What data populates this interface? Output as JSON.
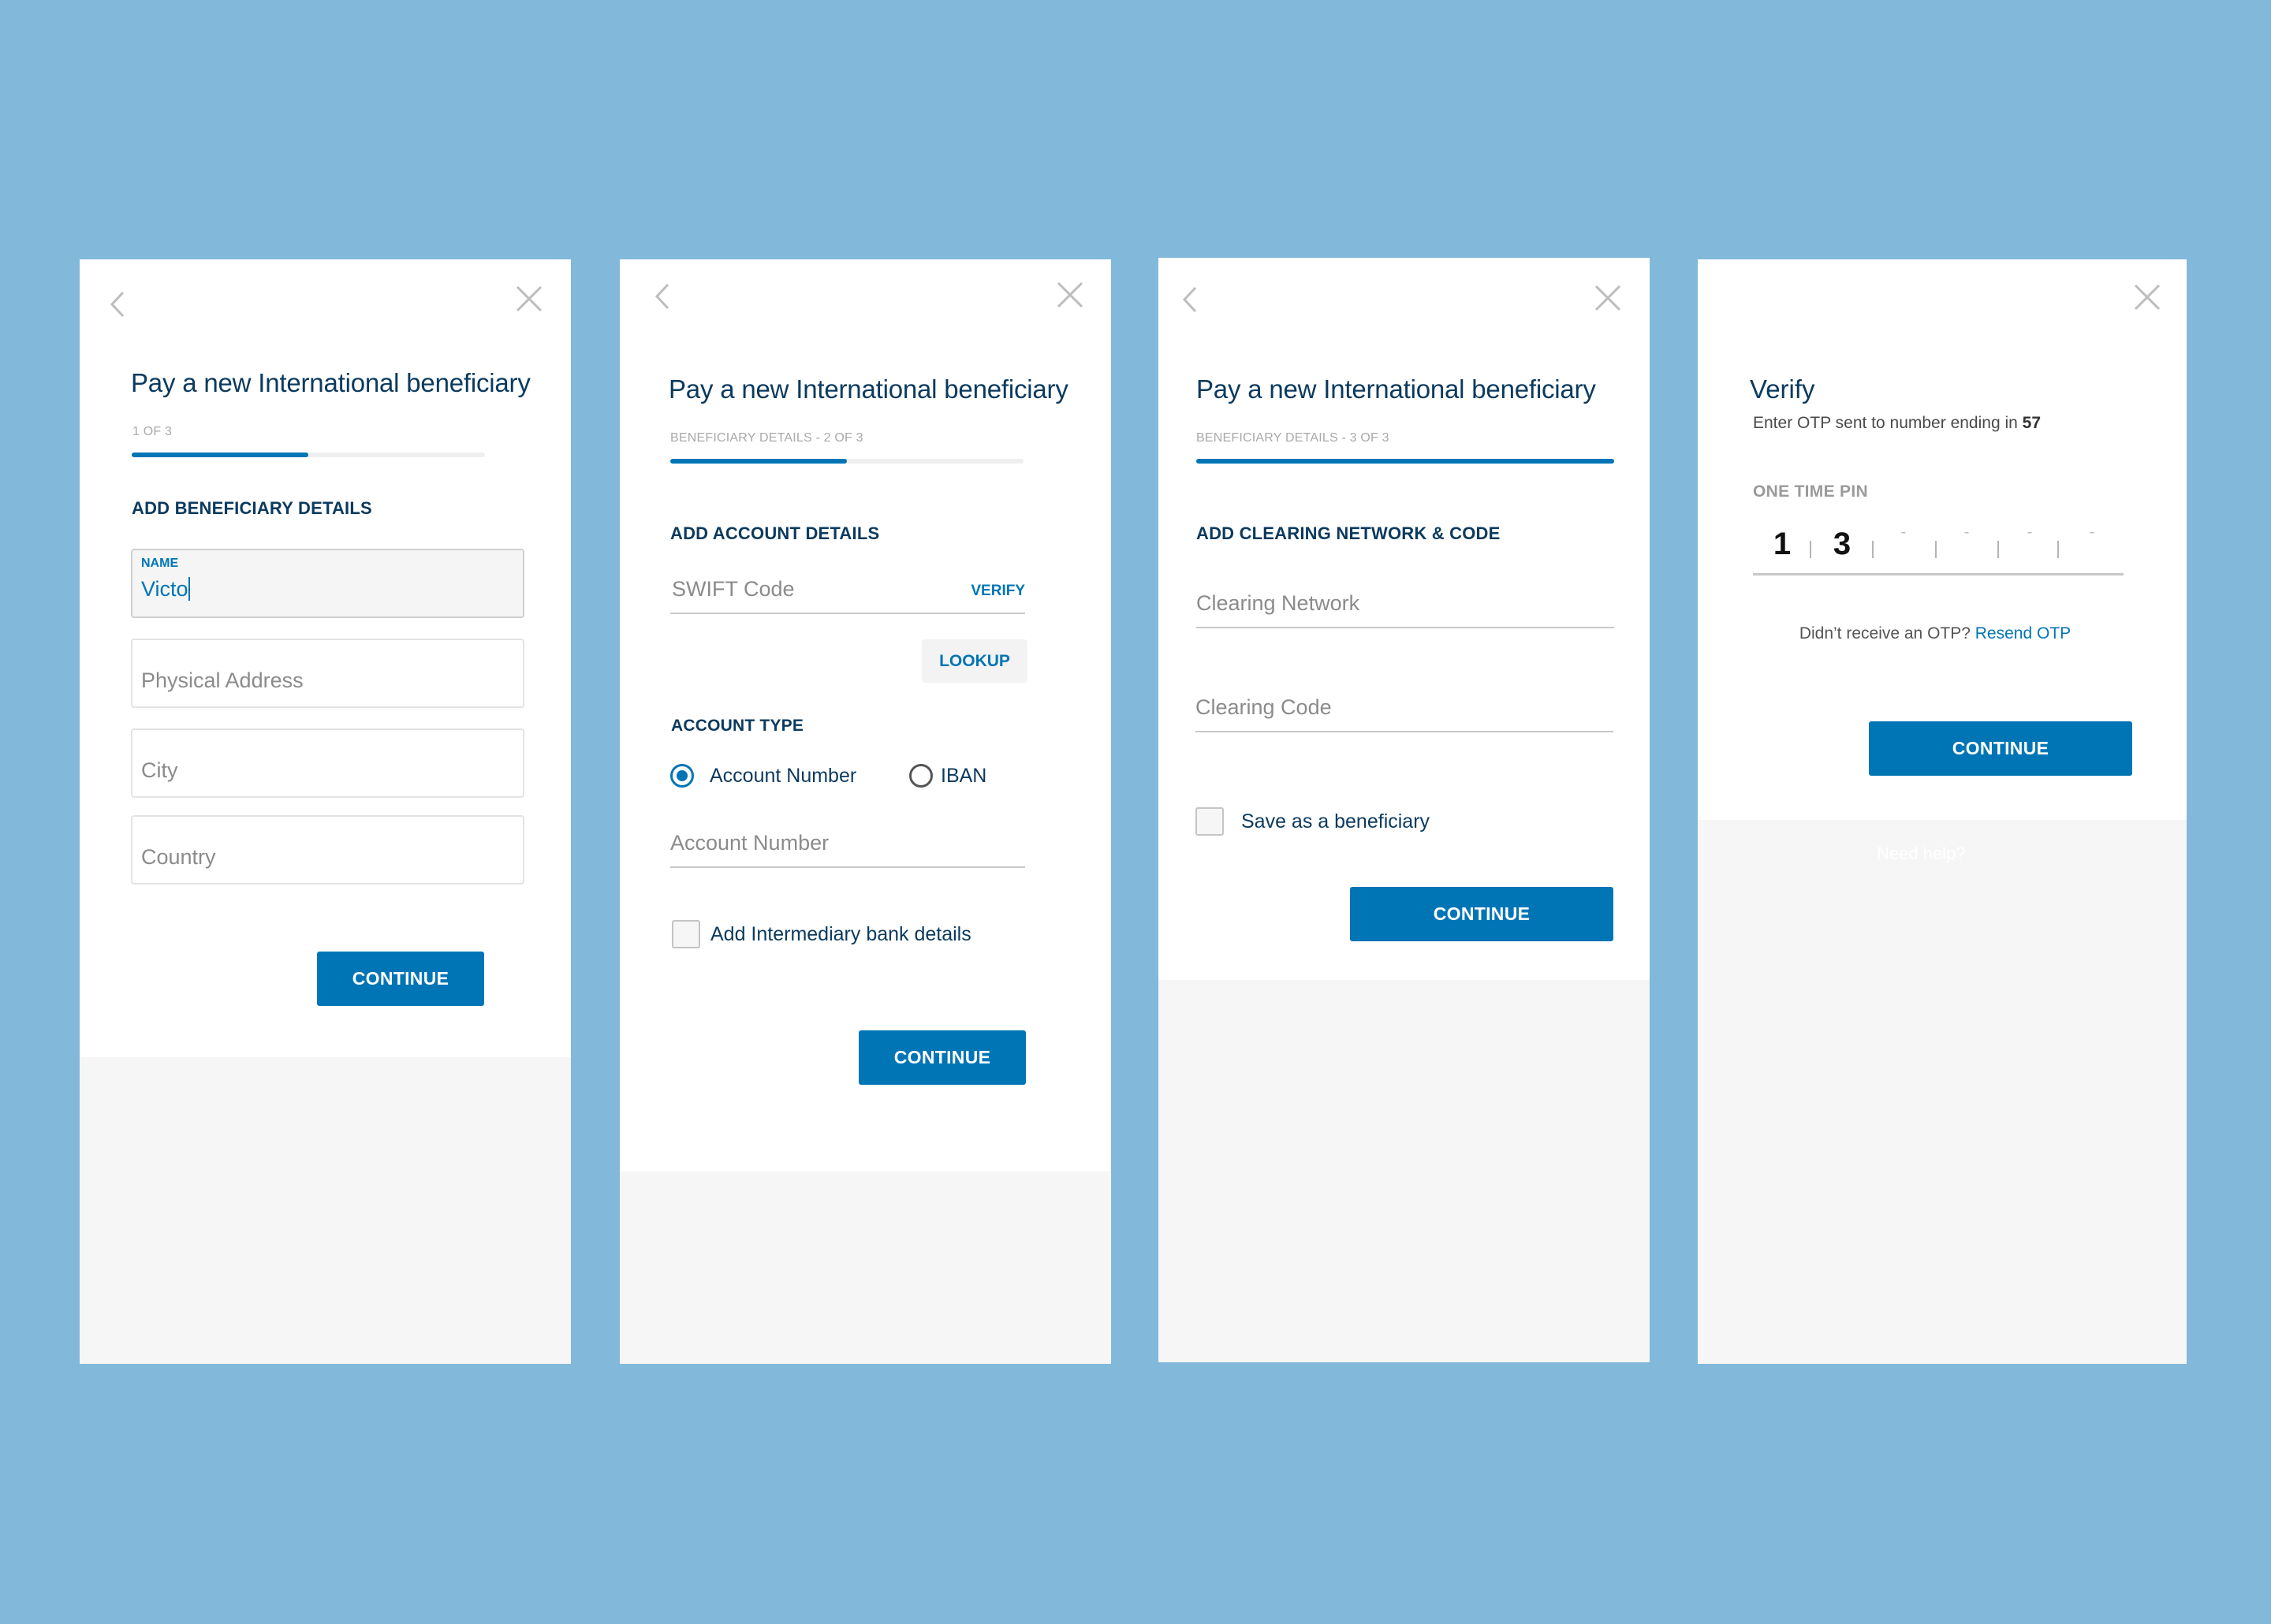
{
  "colors": {
    "background": "#82b9da",
    "accent": "#0075b6",
    "heading": "#0b3a5e"
  },
  "screens": [
    {
      "id": "step1",
      "title": "Pay a new International beneficiary",
      "step_label": "1 OF 3",
      "progress_percent": 50,
      "section_title": "ADD BENEFICIARY DETAILS",
      "fields": [
        {
          "label": "NAME",
          "value": "Victo",
          "active": true
        },
        {
          "placeholder": "Physical Address",
          "value": ""
        },
        {
          "placeholder": "City",
          "value": ""
        },
        {
          "placeholder": "Country",
          "value": ""
        }
      ],
      "continue_label": "CONTINUE"
    },
    {
      "id": "step2",
      "title": "Pay a new International beneficiary",
      "step_label": "BENEFICIARY DETAILS - 2 OF 3",
      "progress_percent": 50,
      "section_title": "ADD ACCOUNT DETAILS",
      "swift_placeholder": "SWIFT Code",
      "verify_label": "VERIFY",
      "lookup_label": "LOOKUP",
      "account_type_title": "ACCOUNT TYPE",
      "account_types": [
        {
          "label": "Account Number",
          "checked": true
        },
        {
          "label": "IBAN",
          "checked": false
        }
      ],
      "account_number_placeholder": "Account Number",
      "intermediary_label": "Add Intermediary bank details",
      "intermediary_checked": false,
      "continue_label": "CONTINUE"
    },
    {
      "id": "step3",
      "title": "Pay a new International beneficiary",
      "step_label": "BENEFICIARY DETAILS - 3 OF 3",
      "progress_percent": 100,
      "section_title": "ADD CLEARING NETWORK & CODE",
      "clearing_network_placeholder": "Clearing Network",
      "clearing_code_placeholder": "Clearing Code",
      "save_beneficiary_label": "Save as a beneficiary",
      "save_beneficiary_checked": false,
      "continue_label": "CONTINUE"
    },
    {
      "id": "verify",
      "title": "Verify",
      "subtitle_prefix": "Enter OTP sent to number ending in ",
      "subtitle_number": "57",
      "otp_label": "ONE TIME PIN",
      "otp_digits": [
        "1",
        "3",
        "-",
        "-",
        "-",
        "-"
      ],
      "resend_prompt": "Didn’t receive an OTP? ",
      "resend_link": "Resend OTP",
      "continue_label": "CONTINUE",
      "need_help_label": "Need help?"
    }
  ]
}
